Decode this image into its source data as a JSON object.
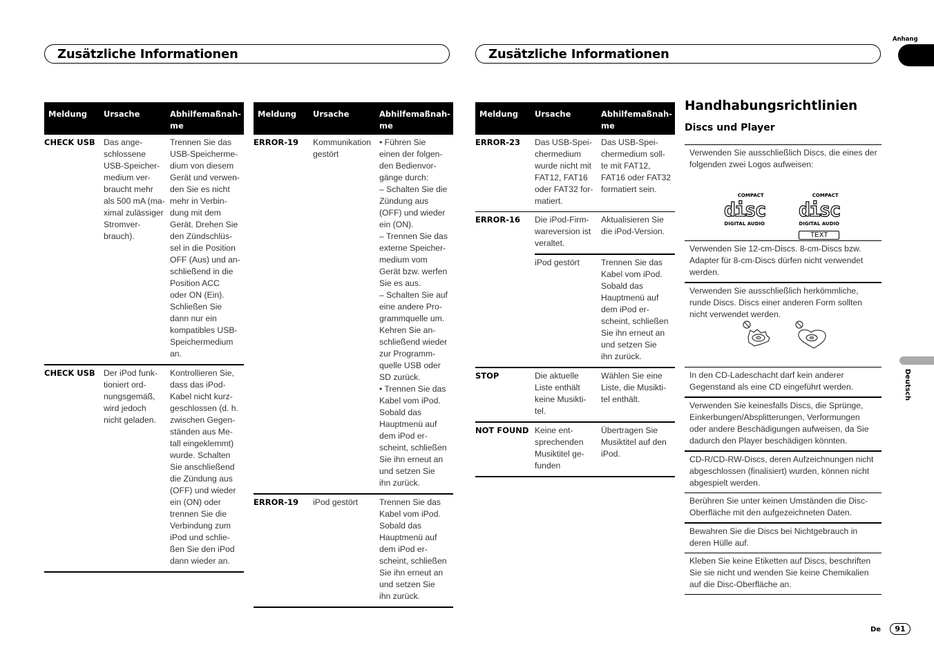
{
  "header": {
    "left_title": "Zusätzliche Informationen",
    "right_title": "Zusätzliche Informationen",
    "section_tab": "Anhang",
    "language_tab": "Deutsch"
  },
  "table_columns": [
    "Meldung",
    "Ursache",
    "Abhilfemaßnah-\nme"
  ],
  "table1": [
    {
      "code": "CHECK USB",
      "cause": "Das ange-\nschlossene\nUSB-Speicher-\nmedium ver-\nbraucht mehr\nals 500 mA (ma-\nximal zulässiger\nStromver-\nbrauch).",
      "action": "Trennen Sie das\nUSB-Speicherme-\ndium von diesem\nGerät und verwen-\nden Sie es nicht\nmehr in Verbin-\ndung mit dem\nGerät. Drehen Sie\nden Zündschlüs-\nsel in die Position\nOFF (Aus) und an-\nschließend in die\nPosition ACC\noder ON (Ein).\nSchließen Sie\ndann nur ein\nkompatibles USB-\nSpeichermedium\nan."
    },
    {
      "code": "CHECK USB",
      "cause": "Der iPod funk-\ntioniert ord-\nnungsgemäß,\nwird jedoch\nnicht geladen.",
      "action": "Kontrollieren Sie,\ndass das iPod-\nKabel nicht kurz-\ngeschlossen (d. h.\nzwischen Gegen-\nständen aus Me-\ntall eingeklemmt)\nwurde. Schalten\nSie anschließend\ndie Zündung aus\n(OFF) und wieder\nein (ON) oder\ntrennen Sie die\nVerbindung zum\niPod und schlie-\nßen Sie den iPod\ndann wieder an."
    }
  ],
  "table2": [
    {
      "code": "ERROR-19",
      "cause": "Kommunikation\ngestört",
      "action": "• Führen Sie\neinen der folgen-\nden Bedienvor-\ngänge durch:\n– Schalten Sie die\nZündung aus\n(OFF) und wieder\nein (ON).\n– Trennen Sie das\nexterne Speicher-\nmedium vom\nGerät bzw. werfen\nSie es aus.\n– Schalten Sie auf\neine andere Pro-\ngrammquelle um.\nKehren Sie an-\nschließend wieder\nzur Programm-\nquelle USB oder\nSD zurück.\n• Trennen Sie das\nKabel vom iPod.\nSobald das\nHauptmenü auf\ndem iPod er-\nscheint, schließen\nSie ihn erneut an\nund setzen Sie\nihn zurück."
    },
    {
      "code": "ERROR-19",
      "cause": "iPod gestört",
      "action": "Trennen Sie das\nKabel vom iPod.\nSobald das\nHauptmenü auf\ndem iPod er-\nscheint, schließen\nSie ihn erneut an\nund setzen Sie\nihn zurück."
    }
  ],
  "table3": [
    {
      "code": "ERROR-23",
      "cause": "Das USB-Spei-\nchermedium\nwurde nicht mit\nFAT12, FAT16\noder FAT32 for-\nmatiert.",
      "action": "Das USB-Spei-\nchermedium soll-\nte mit FAT12,\nFAT16 oder FAT32\nformatiert sein."
    },
    {
      "code": "ERROR-16",
      "cause": "Die iPod-Firm-\nwareversion ist\nveraltet.",
      "action": "Aktualisieren Sie\ndie iPod-Version.",
      "sub": {
        "cause": "iPod gestört",
        "action": "Trennen Sie das\nKabel vom iPod.\nSobald das\nHauptmenü auf\ndem iPod er-\nscheint, schließen\nSie ihn erneut an\nund setzen Sie\nihn zurück."
      }
    },
    {
      "code": "STOP",
      "cause": "Die aktuelle\nListe enthält\nkeine Musikti-\ntel.",
      "action": "Wählen Sie eine\nListe, die Musikti-\ntel enthält."
    },
    {
      "code": "NOT FOUND",
      "cause": "Keine ent-\nsprechenden\nMusiktitel ge-\nfunden",
      "action": "Übertragen Sie\nMusiktitel auf den\niPod."
    }
  ],
  "guidelines": {
    "title": "Handhabungsrichtlinien",
    "subtitle": "Discs und Player",
    "logo": {
      "top": "COMPACT",
      "word": "disc",
      "bottom": "DIGITAL AUDIO",
      "text_badge": "TEXT"
    },
    "notes": [
      "Verwenden Sie ausschließlich Discs, die eines der folgenden zwei Logos aufweisen:",
      "Verwenden Sie 12-cm-Discs. 8-cm-Discs bzw. Adapter für 8-cm-Discs dürfen nicht verwendet werden.",
      "Verwenden Sie ausschließlich herkömmliche, runde Discs. Discs einer anderen Form sollten nicht verwendet werden.",
      "In den CD-Ladeschacht darf kein anderer Gegenstand als eine CD eingeführt werden.",
      "Verwenden Sie keinesfalls Discs, die Sprünge, Einkerbungen/Absplitterungen, Verformungen oder andere Beschädigungen aufweisen, da Sie dadurch den Player beschädigen könnten.",
      "CD-R/CD-RW-Discs, deren Aufzeichnungen nicht abgeschlossen (finalisiert) wurden, können nicht abgespielt werden.",
      "Berühren Sie unter keinen Umständen die Disc-Oberfläche mit den aufgezeichneten Daten.",
      "Bewahren Sie die Discs bei Nichtgebrauch in deren Hülle auf.",
      "Kleben Sie keine Etiketten auf Discs, beschriften Sie sie nicht und wenden Sie keine Chemikalien auf die Disc-Oberfläche an."
    ]
  },
  "footer": {
    "language_code": "De",
    "page_number": "91"
  }
}
